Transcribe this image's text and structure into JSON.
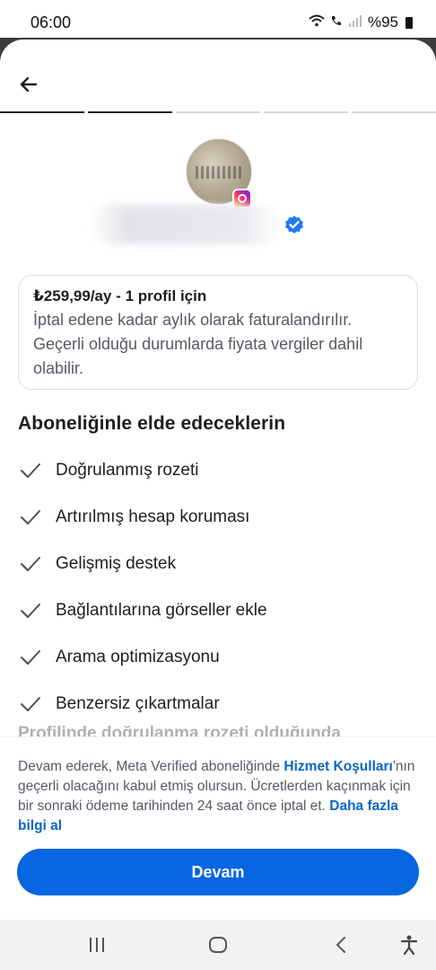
{
  "status_bar": {
    "time": "06:00",
    "battery": "%95",
    "icons": [
      "wifi-icon",
      "wifi-calling-icon",
      "signal-icon",
      "battery-icon"
    ]
  },
  "header": {
    "back_icon": "arrow-left-icon",
    "progress": {
      "total_steps": 5,
      "completed_steps": 2
    }
  },
  "profile": {
    "avatar_icon": "profile-avatar",
    "platform_badge": "instagram-icon",
    "verified_badge": "verified-icon"
  },
  "pricing": {
    "title": "₺259,99/ay - 1 profil için",
    "description": "İptal edene kadar aylık olarak faturalandırılır. Geçerli olduğu durumlarda fiyata vergiler dahil olabilir."
  },
  "benefits": {
    "title": "Aboneliğinle elde edeceklerin",
    "items": [
      {
        "label": "Doğrulanmış rozeti",
        "icon": "check-icon"
      },
      {
        "label": "Artırılmış hesap koruması",
        "icon": "check-icon"
      },
      {
        "label": "Gelişmiş destek",
        "icon": "check-icon"
      },
      {
        "label": "Bağlantılarına görseller ekle",
        "icon": "check-icon"
      },
      {
        "label": "Arama optimizasyonu",
        "icon": "check-icon"
      },
      {
        "label": "Benzersiz çıkartmalar",
        "icon": "check-icon"
      }
    ],
    "partial_next_text": "Profilinde doğrulanma rozeti olduğunda"
  },
  "footer": {
    "legal_part1": "Devam ederek, Meta Verified aboneliğinde ",
    "terms_link": "Hizmet Koşulları",
    "legal_part2": "'nın geçerli olacağını kabul etmiş olursun. Ücretlerden kaçınmak için bir sonraki ödeme tarihinden 24 saat önce iptal et. ",
    "learn_more_link": "Daha fazla bilgi al",
    "continue_button": "Devam"
  },
  "nav_bar": {
    "recents_icon": "recents-icon",
    "home_icon": "home-icon",
    "back_icon": "chevron-left-icon",
    "accessibility_icon": "accessibility-icon"
  },
  "colors": {
    "primary": "#0866e0",
    "link": "#0a66c2",
    "verified": "#1d7cf2",
    "text": "#1c1e21",
    "secondary_text": "#555b63"
  }
}
